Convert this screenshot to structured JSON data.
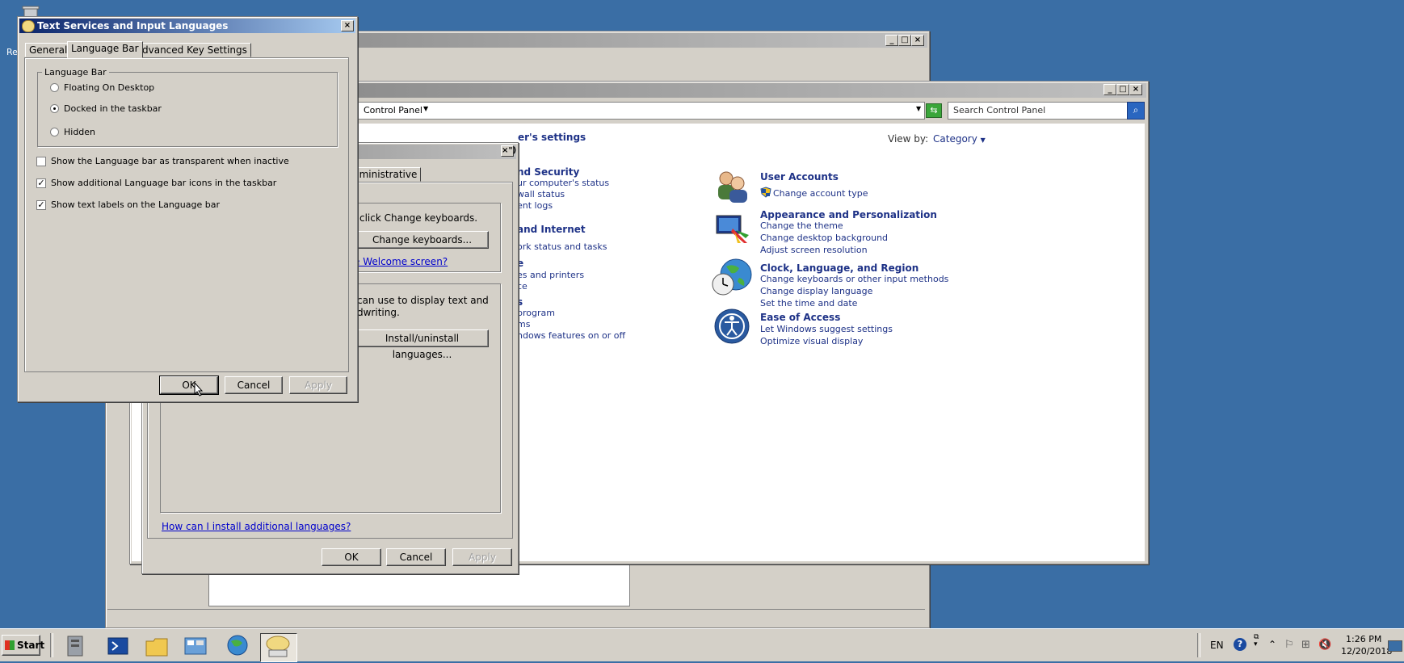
{
  "desktop": {
    "recycle_label": "Re"
  },
  "control_panel": {
    "address_crumb": "Control Panel",
    "search_placeholder": "Search Control Panel",
    "heading": "er's settings",
    "view_by_label": "View by:",
    "view_by_value": "Category",
    "left_partial": [
      {
        "text": "nd Security",
        "head": true
      },
      {
        "text": "ur computer's status"
      },
      {
        "text": "wall status"
      },
      {
        "text": "ent logs"
      },
      {
        "text": "and Internet",
        "head": true
      },
      {
        "text": "ork status and tasks"
      },
      {
        "text": "e",
        "head": true
      },
      {
        "text": "es and printers"
      },
      {
        "text": "ce"
      },
      {
        "text": "s",
        "head": true
      },
      {
        "text": "program"
      },
      {
        "text": "ms"
      },
      {
        "text": "ndows features on or off"
      }
    ],
    "categories": [
      {
        "title": "User Accounts",
        "links": [
          "Change account type"
        ],
        "icon": "users-icon"
      },
      {
        "title": "Appearance and Personalization",
        "links": [
          "Change the theme",
          "Change desktop background",
          "Adjust screen resolution"
        ],
        "icon": "appearance-icon"
      },
      {
        "title": "Clock, Language, and Region",
        "links": [
          "Change keyboards or other input methods",
          "Change display language",
          "Set the time and date"
        ],
        "icon": "clock-globe-icon"
      },
      {
        "title": "Ease of Access",
        "links": [
          "Let Windows suggest settings",
          "Optimize visual display"
        ],
        "icon": "ease-of-access-icon"
      }
    ]
  },
  "region_dialog": {
    "tab_partial": "dministrative",
    "text1": "click Change keyboards.",
    "change_keyboards": "Change keyboards...",
    "welcome_link": "e Welcome screen?",
    "text2": "can use to display text and",
    "text3": "dwriting.",
    "install_uninstall": "Install/uninstall languages...",
    "how_link": "How can I install additional languages?",
    "ok": "OK",
    "cancel": "Cancel",
    "apply": "Apply"
  },
  "text_services": {
    "title": "Text Services and Input Languages",
    "tabs": [
      "General",
      "Language Bar",
      "Advanced Key Settings"
    ],
    "group_label": "Language Bar",
    "radios": [
      {
        "label": "Floating On Desktop",
        "selected": false
      },
      {
        "label": "Docked in the taskbar",
        "selected": true
      },
      {
        "label": "Hidden",
        "selected": false
      }
    ],
    "checks": [
      {
        "label": "Show the Language bar as transparent when inactive",
        "checked": false
      },
      {
        "label": "Show additional Language bar icons in the taskbar",
        "checked": true
      },
      {
        "label": "Show text labels on the Language bar",
        "checked": true
      }
    ],
    "ok": "OK",
    "cancel": "Cancel",
    "apply": "Apply"
  },
  "taskbar": {
    "start": "Start",
    "lang": "EN",
    "time": "1:26 PM",
    "date": "12/20/2018"
  }
}
